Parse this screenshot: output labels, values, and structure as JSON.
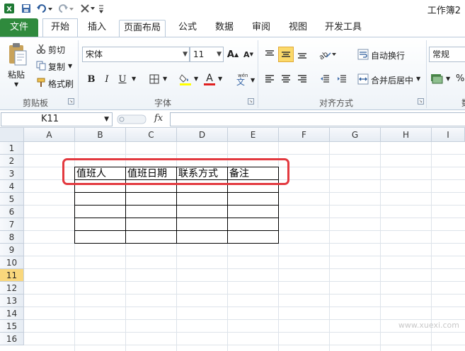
{
  "app": {
    "title": "工作簿2",
    "accent": "#2f8a3d"
  },
  "quick_access": [
    {
      "name": "excel-logo-icon"
    },
    {
      "name": "save-icon"
    },
    {
      "name": "undo-icon"
    },
    {
      "name": "redo-icon"
    },
    {
      "name": "customize-icon"
    }
  ],
  "tabs": [
    {
      "label": "文件",
      "file": true
    },
    {
      "label": "开始",
      "active": true
    },
    {
      "label": "插入"
    },
    {
      "label": "页面布局"
    },
    {
      "label": "公式"
    },
    {
      "label": "数据"
    },
    {
      "label": "审阅"
    },
    {
      "label": "视图"
    },
    {
      "label": "开发工具"
    }
  ],
  "ribbon": {
    "clipboard": {
      "paste": "粘贴",
      "cut": "剪切",
      "copy": "复制",
      "format_painter": "格式刷",
      "label": "剪贴板"
    },
    "font": {
      "font_name": "宋体",
      "font_size": "11",
      "bold": "B",
      "italic": "I",
      "underline": "U",
      "label": "字体"
    },
    "alignment": {
      "wrap_text": "自动换行",
      "merge_center": "合并后居中",
      "label": "对齐方式"
    },
    "number": {
      "format": "常规",
      "label": "数"
    }
  },
  "formula_bar": {
    "name_box": "K11",
    "fx": "fx",
    "value": ""
  },
  "sheet": {
    "columns": [
      "A",
      "B",
      "C",
      "D",
      "E",
      "F",
      "G",
      "H",
      "I"
    ],
    "rows": [
      "1",
      "2",
      "3",
      "4",
      "5",
      "6",
      "7",
      "8",
      "9",
      "10",
      "11",
      "12",
      "13",
      "14",
      "15",
      "16"
    ],
    "selected_row": "11",
    "headers": [
      "值班人",
      "值班日期",
      "联系方式",
      "备注"
    ]
  },
  "watermark": "www.xuexi.com"
}
